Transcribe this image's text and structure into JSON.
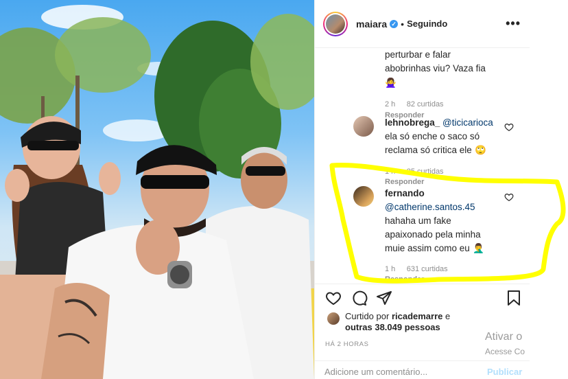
{
  "post": {
    "username": "maiara",
    "follow_status": "Seguindo",
    "more_label": "•••"
  },
  "comments": [
    {
      "text_line1": "perturbar e falar",
      "text_line2": "abobrinhas viu? Vaza fia",
      "emoji": "🙅‍♀️",
      "time": "2 h",
      "likes": "82 curtidas",
      "reply": "Responder"
    },
    {
      "user": "lehnobrega_",
      "mention": "@ticicarioca",
      "text_line1": "ela só enche o saco só",
      "text_line2": "reclama só critica ele",
      "emoji": "🙄",
      "time": "1 h",
      "likes": "25 curtidas",
      "reply": "Responder"
    },
    {
      "user": "fernando",
      "mention": "@catherine.santos.45",
      "text_line1": "hahaha um fake",
      "text_line2": "apaixonado pela minha",
      "text_line3": "muie assim como eu",
      "emoji": "🤦‍♂️",
      "time": "1 h",
      "likes": "631 curtidas",
      "reply": "Responder"
    }
  ],
  "likes_summary": {
    "prefix": "Curtido por",
    "user": "ricademarre",
    "connector": "e",
    "others": "outras 38.049 pessoas"
  },
  "timestamp": "HÁ 2 HORAS",
  "add_comment": {
    "placeholder": "Adicione um comentário...",
    "publish_label": "Publicar"
  },
  "watermark": {
    "line1": "Ativar o",
    "line2": "Acesse Co"
  },
  "colors": {
    "highlight": "#ffff00",
    "verified": "#3897f0",
    "link": "#00376b",
    "muted": "#8e8e8e"
  }
}
